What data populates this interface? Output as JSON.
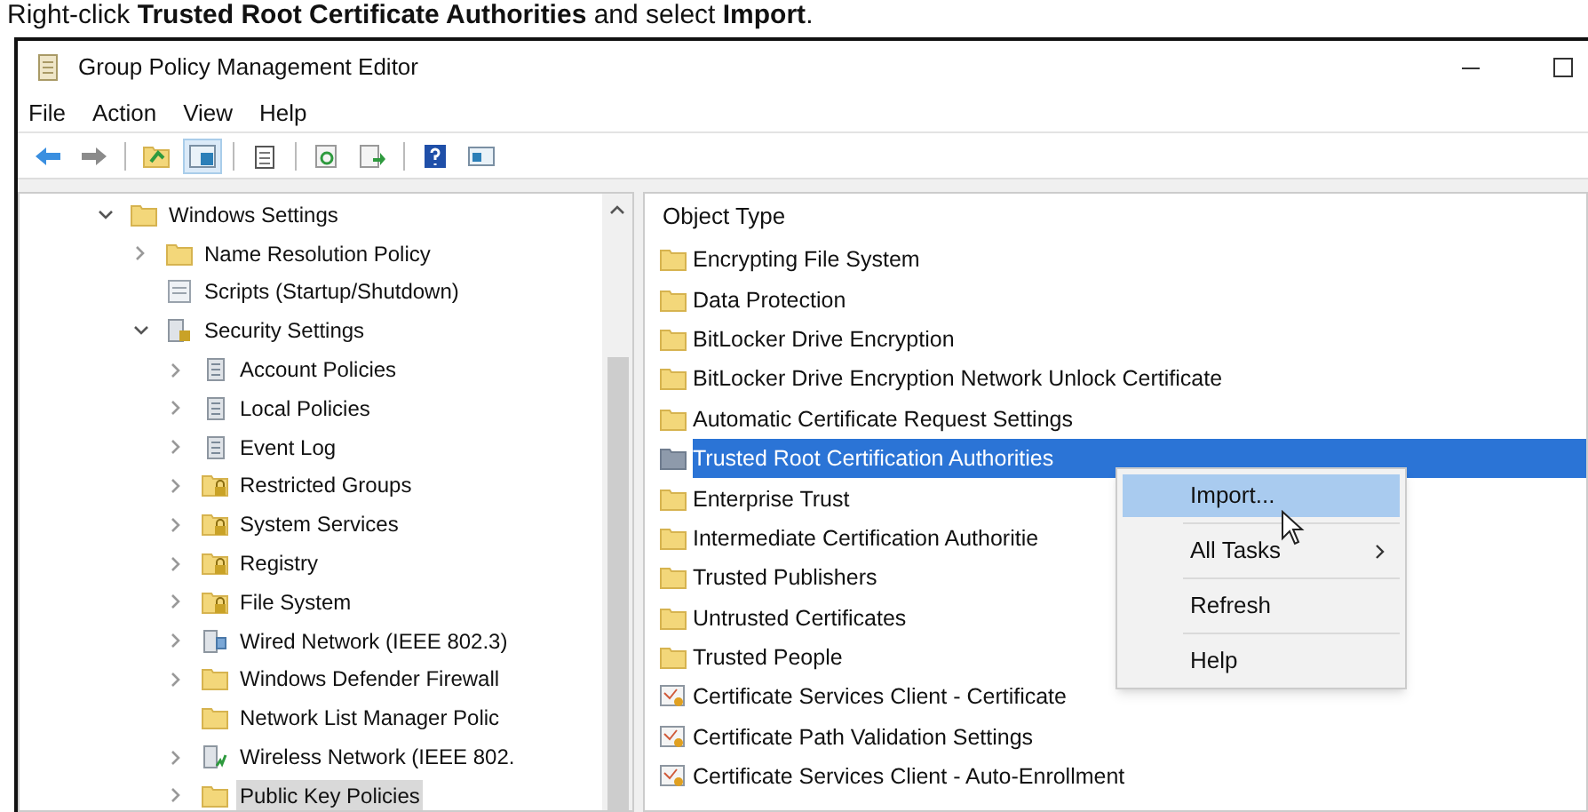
{
  "caption": "Right-click **Trusted Root Certificate Authorities** and select **Import**.",
  "window": {
    "title": "Group Policy Management Editor"
  },
  "menu": [
    "File",
    "Action",
    "View",
    "Help"
  ],
  "toolbar": [
    {
      "kind": "back",
      "selected": false
    },
    {
      "kind": "forward",
      "selected": false
    },
    {
      "kind": "up",
      "selected": false
    },
    {
      "kind": "tree",
      "selected": true
    },
    {
      "kind": "clipboard",
      "selected": false
    },
    {
      "kind": "refresh",
      "selected": false
    },
    {
      "kind": "export",
      "selected": false
    },
    {
      "kind": "help",
      "selected": false
    },
    {
      "kind": "pane",
      "selected": false
    }
  ],
  "tree": [
    {
      "label": "Windows Settings",
      "kind": "folder",
      "expanded": true,
      "selected": false,
      "children": [
        {
          "label": "Name Resolution Policy",
          "kind": "folder",
          "expanded": false,
          "selected": false
        },
        {
          "label": "Scripts (Startup/Shutdown)",
          "kind": "script",
          "selected": false
        },
        {
          "label": "Security Settings",
          "kind": "security",
          "expanded": true,
          "selected": false,
          "children": [
            {
              "label": "Account Policies",
              "kind": "server",
              "expanded": false,
              "selected": false
            },
            {
              "label": "Local Policies",
              "kind": "server",
              "expanded": false,
              "selected": false
            },
            {
              "label": "Event Log",
              "kind": "server",
              "expanded": false,
              "selected": false
            },
            {
              "label": "Restricted Groups",
              "kind": "lockfolder",
              "expanded": false,
              "selected": false
            },
            {
              "label": "System Services",
              "kind": "lockfolder",
              "expanded": false,
              "selected": false
            },
            {
              "label": "Registry",
              "kind": "lockfolder",
              "expanded": false,
              "selected": false
            },
            {
              "label": "File System",
              "kind": "lockfolder",
              "expanded": false,
              "selected": false
            },
            {
              "label": "Wired Network (IEEE 802.3)",
              "kind": "network",
              "expanded": false,
              "selected": false
            },
            {
              "label": "Windows Defender Firewall",
              "kind": "folder",
              "expanded": false,
              "selected": false
            },
            {
              "label": "Network List Manager Polic",
              "kind": "folder",
              "selected": false
            },
            {
              "label": "Wireless Network (IEEE 802.",
              "kind": "wireless",
              "expanded": false,
              "selected": false
            },
            {
              "label": "Public Key Policies",
              "kind": "folder",
              "expanded": false,
              "selected": true
            }
          ]
        }
      ]
    }
  ],
  "list": {
    "header": "Object Type",
    "items": [
      {
        "label": "Encrypting File System",
        "kind": "folder",
        "selected": false
      },
      {
        "label": "Data Protection",
        "kind": "folder",
        "selected": false
      },
      {
        "label": "BitLocker Drive Encryption",
        "kind": "folder",
        "selected": false
      },
      {
        "label": "BitLocker Drive Encryption Network Unlock Certificate",
        "kind": "folder",
        "selected": false
      },
      {
        "label": "Automatic Certificate Request Settings",
        "kind": "folder",
        "selected": false
      },
      {
        "label": "Trusted Root Certification Authorities",
        "kind": "folder",
        "selected": true
      },
      {
        "label": "Enterprise Trust",
        "kind": "folder",
        "selected": false
      },
      {
        "label": "Intermediate Certification Authoritie",
        "kind": "folder",
        "selected": false
      },
      {
        "label": "Trusted Publishers",
        "kind": "folder",
        "selected": false
      },
      {
        "label": "Untrusted Certificates",
        "kind": "folder",
        "selected": false
      },
      {
        "label": "Trusted People",
        "kind": "folder",
        "selected": false
      },
      {
        "label": "Certificate Services Client - Certificate",
        "kind": "cert",
        "selected": false
      },
      {
        "label": "Certificate Path Validation Settings",
        "kind": "cert",
        "selected": false
      },
      {
        "label": "Certificate Services Client - Auto-Enrollment",
        "kind": "cert",
        "selected": false
      }
    ]
  },
  "context_menu": [
    {
      "label": "Import...",
      "kind": "item",
      "selected": true
    },
    {
      "label": "All Tasks",
      "kind": "submenu",
      "selected": false
    },
    {
      "label": "Refresh",
      "kind": "item",
      "selected": false
    },
    {
      "label": "Help",
      "kind": "item",
      "selected": false
    }
  ]
}
